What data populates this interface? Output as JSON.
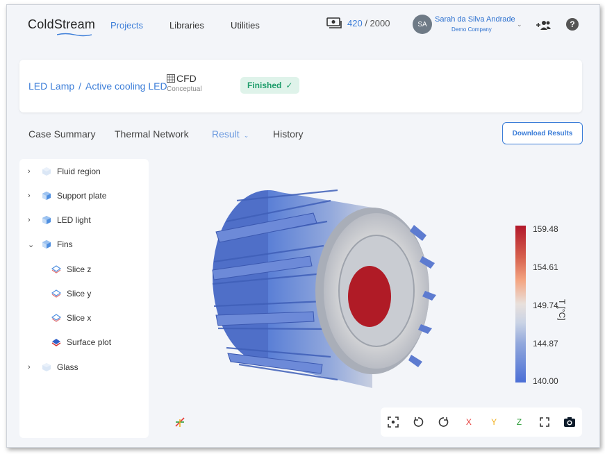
{
  "app": {
    "logo": "ColdStream",
    "nav": [
      "Projects",
      "Libraries",
      "Utilities"
    ],
    "credits": {
      "used": "420",
      "total": " / 2000"
    },
    "user": {
      "initials": "SA",
      "name": "Sarah da Silva Andrade",
      "company": "Demo Company"
    }
  },
  "breadcrumb": {
    "project": "LED Lamp",
    "separator": "/",
    "case": "Active cooling LED",
    "analysis_type": "CFD",
    "analysis_sub": "Conceptual",
    "status": "Finished"
  },
  "tabs": {
    "items": [
      "Case Summary",
      "Thermal Network",
      "Result",
      "History"
    ],
    "active": "Result",
    "download_label": "Download Results"
  },
  "tree": [
    {
      "label": "Fluid region",
      "expanded": false,
      "icon": "cube-faded-icon"
    },
    {
      "label": "Support plate",
      "expanded": false,
      "icon": "cube-icon"
    },
    {
      "label": "LED light",
      "expanded": false,
      "icon": "cube-icon"
    },
    {
      "label": "Fins",
      "expanded": true,
      "icon": "cube-icon"
    },
    {
      "label": "Slice z",
      "icon": "layer-outline-icon"
    },
    {
      "label": "Slice y",
      "icon": "layer-outline-icon"
    },
    {
      "label": "Slice x",
      "icon": "layer-outline-icon"
    },
    {
      "label": "Surface plot",
      "icon": "layer-filled-icon"
    },
    {
      "label": "Glass",
      "expanded": false,
      "icon": "cube-faded-icon"
    }
  ],
  "colorbar": {
    "labels": [
      "159.48",
      "154.61",
      "149.74",
      "144.87",
      "140.00"
    ],
    "unit": "T [°C]",
    "colors": {
      "max": "#b2182b",
      "mid": "#e8e0dc",
      "min": "#4b6fd6"
    }
  },
  "toolbar": {
    "x_label": "X",
    "y_label": "Y",
    "z_label": "Z",
    "x_color": "#e53935",
    "y_color": "#f2b01e",
    "z_color": "#2e9d3a"
  },
  "colors": {
    "accent": "#3b7dd8",
    "status_bg": "#dff3ea",
    "status_fg": "#1f9d6b"
  }
}
